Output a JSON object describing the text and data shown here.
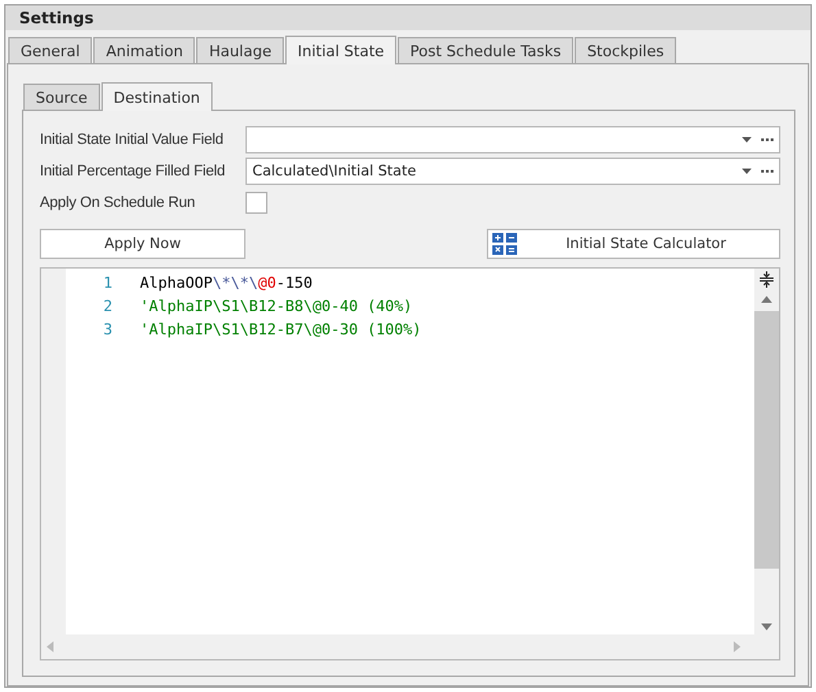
{
  "panel": {
    "title": "Settings"
  },
  "tabs": [
    {
      "label": "General",
      "selected": false
    },
    {
      "label": "Animation",
      "selected": false
    },
    {
      "label": "Haulage",
      "selected": false
    },
    {
      "label": "Initial State",
      "selected": true
    },
    {
      "label": "Post Schedule Tasks",
      "selected": false
    },
    {
      "label": "Stockpiles",
      "selected": false
    }
  ],
  "subtabs": [
    {
      "label": "Source",
      "selected": false
    },
    {
      "label": "Destination",
      "selected": true
    }
  ],
  "fields": [
    {
      "label": "Initial State Initial Value Field",
      "kind": "combo"
    },
    {
      "label": "Initial Percentage Filled Field",
      "kind": "combo",
      "value": "Calculated\\Initial State"
    },
    {
      "label": "Apply On Schedule Run",
      "kind": "checkbox",
      "checked": false
    }
  ],
  "buttons": [
    {
      "label": "Apply Now",
      "kind": "plain"
    },
    {
      "label": "Initial State Calculator",
      "kind": "calculator"
    }
  ],
  "editor": {
    "lines": [
      {
        "number": "1",
        "segments": [
          {
            "text": "AlphaOOP",
            "kind": "plain"
          },
          {
            "text": "\\*\\*\\",
            "kind": "escape"
          },
          {
            "text": "@0",
            "kind": "marker"
          },
          {
            "text": "-150",
            "kind": "plain"
          }
        ]
      },
      {
        "number": "2",
        "segments": [
          {
            "text": "'AlphaIP\\S1\\B12-B8\\@0-40 (40%)",
            "kind": "comment"
          }
        ]
      },
      {
        "number": "3",
        "segments": [
          {
            "text": "'AlphaIP\\S1\\B12-B7\\@0-30 (100%)",
            "kind": "comment"
          }
        ]
      }
    ]
  }
}
